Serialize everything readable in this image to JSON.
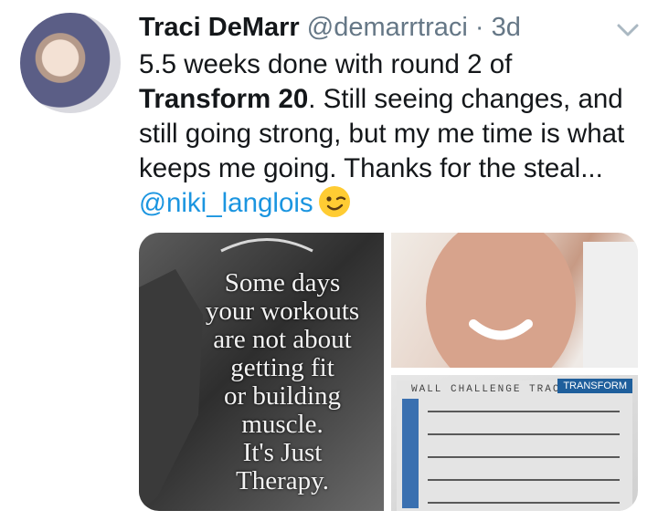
{
  "tweet": {
    "author_name": "Traci DeMarr",
    "handle": "@demarrtraci",
    "separator": "·",
    "time": "3d",
    "text_before": "5.5 weeks done with round 2 of",
    "text_bold": "Transform 20",
    "text_after": ". Still seeing changes, and still going strong, but my me time is what keeps me going. Thanks for the steal...",
    "mention": "@niki_langlois",
    "emoji": "winking-face"
  },
  "media": {
    "quote_text": "Some days\nyour workouts\nare not about\ngetting fit\nor building\nmuscle.\nIt's Just\nTherapy.",
    "tracker_title": "WALL CHALLENGE TRACKER",
    "tracker_brand": "TRANSFORM"
  },
  "icons": [
    "chevron-down-icon",
    "winking-face-emoji"
  ],
  "colors": {
    "link": "#1b95e0",
    "text": "#14171a",
    "muted": "#657786"
  }
}
